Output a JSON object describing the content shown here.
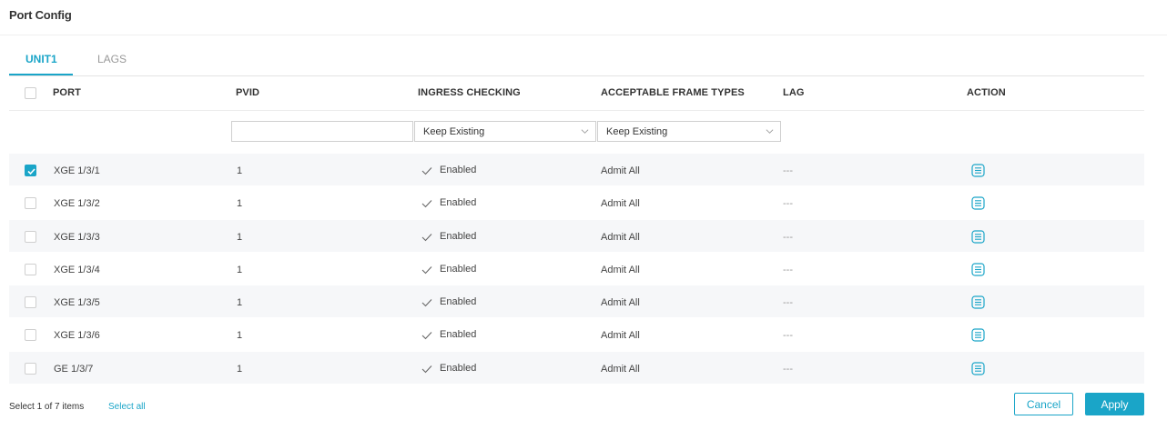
{
  "page": {
    "title": "Port Config"
  },
  "tabs": [
    {
      "label": "UNIT1",
      "active": true
    },
    {
      "label": "LAGS",
      "active": false
    }
  ],
  "table": {
    "headers": {
      "port": "PORT",
      "pvid": "PVID",
      "ingress": "INGRESS CHECKING",
      "frame_types": "ACCEPTABLE FRAME TYPES",
      "lag": "LAG",
      "action": "ACTION"
    },
    "filter": {
      "pvid_value": "",
      "ingress_selected": "Keep Existing",
      "frame_types_selected": "Keep Existing"
    },
    "rows": [
      {
        "checked": true,
        "port": "XGE 1/3/1",
        "pvid": "1",
        "ingress": "Enabled",
        "frame_types": "Admit All",
        "lag": "---"
      },
      {
        "checked": false,
        "port": "XGE 1/3/2",
        "pvid": "1",
        "ingress": "Enabled",
        "frame_types": "Admit All",
        "lag": "---"
      },
      {
        "checked": false,
        "port": "XGE 1/3/3",
        "pvid": "1",
        "ingress": "Enabled",
        "frame_types": "Admit All",
        "lag": "---"
      },
      {
        "checked": false,
        "port": "XGE 1/3/4",
        "pvid": "1",
        "ingress": "Enabled",
        "frame_types": "Admit All",
        "lag": "---"
      },
      {
        "checked": false,
        "port": "XGE 1/3/5",
        "pvid": "1",
        "ingress": "Enabled",
        "frame_types": "Admit All",
        "lag": "---"
      },
      {
        "checked": false,
        "port": "XGE 1/3/6",
        "pvid": "1",
        "ingress": "Enabled",
        "frame_types": "Admit All",
        "lag": "---"
      },
      {
        "checked": false,
        "port": "GE 1/3/7",
        "pvid": "1",
        "ingress": "Enabled",
        "frame_types": "Admit All",
        "lag": "---"
      }
    ]
  },
  "footer": {
    "selection_text": "Select 1 of 7 items",
    "select_all_label": "Select all",
    "cancel_label": "Cancel",
    "apply_label": "Apply"
  },
  "colors": {
    "accent": "#1aa5c8",
    "row_alt": "#f6f7f9",
    "text": "#333333"
  },
  "icons": {
    "check": "check-icon",
    "action": "list-detail-icon",
    "dropdown": "chevron-down-icon"
  }
}
